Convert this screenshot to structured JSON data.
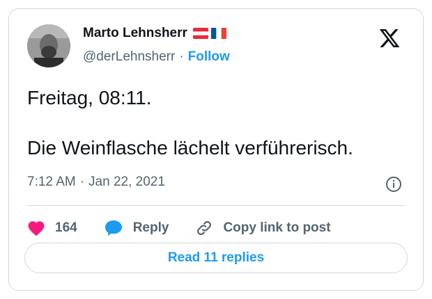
{
  "author": {
    "name": "Marto Lehnsherr",
    "handle": "@derLehnsherr",
    "separator": "·",
    "follow_label": "Follow",
    "flags": [
      "austria-flag-icon",
      "france-flag-icon"
    ]
  },
  "tweet": {
    "text": "Freitag, 08:11.\n\nDie Weinflasche lächelt verführerisch.",
    "time": "7:12 AM",
    "separator": "·",
    "date": "Jan 22, 2021"
  },
  "actions": {
    "likes_count": "164",
    "reply_label": "Reply",
    "copy_link_label": "Copy link to post"
  },
  "footer": {
    "read_replies_label": "Read 11 replies"
  },
  "colors": {
    "accent": "#1d9bf0",
    "like": "#f91880",
    "muted": "#536471",
    "border": "#cfd9de"
  },
  "icons": {
    "platform": "x-logo-icon",
    "info": "info-icon",
    "like": "heart-icon",
    "reply": "speech-bubble-icon",
    "copy": "link-icon"
  }
}
